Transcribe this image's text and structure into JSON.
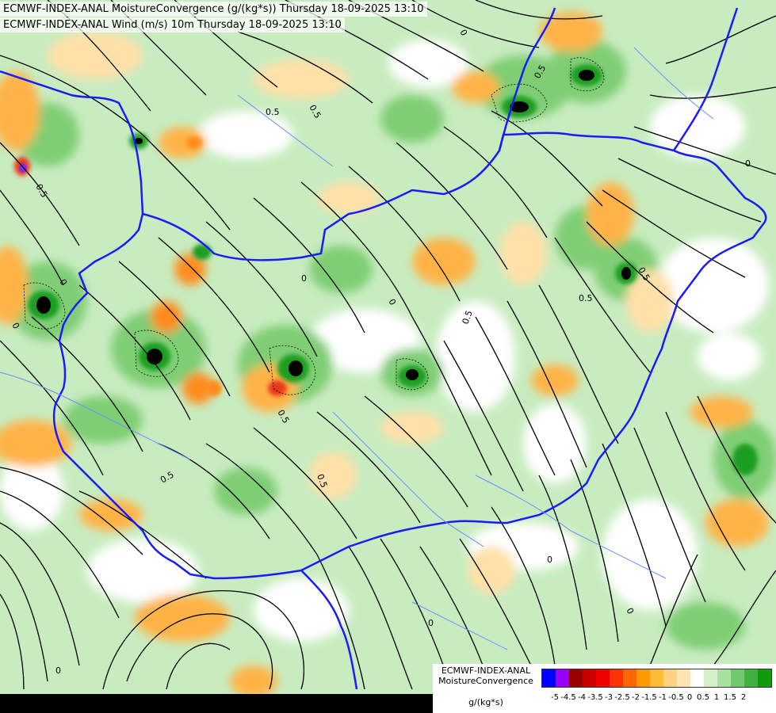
{
  "titles": {
    "line1": "ECMWF-INDEX-ANAL MoistureConvergence (g/(kg*s)) Thursday 18-09-2025 13:10",
    "line2": "ECMWF-INDEX-ANAL Wind (m/s) 10m Thursday 18-09-2025 13:10"
  },
  "legend": {
    "model": "ECMWF-INDEX-ANAL",
    "parameter": "MoistureConvergence",
    "units": "g/(kg*s)",
    "colors": [
      "#0000ff",
      "#9900ff",
      "#990000",
      "#cc0000",
      "#ee0000",
      "#ff3300",
      "#ff6600",
      "#ff9900",
      "#ffbb33",
      "#ffd27f",
      "#ffe5b4",
      "#ffffff",
      "#d4f0c8",
      "#a8e0a0",
      "#70c870",
      "#40b040",
      "#109a10"
    ],
    "tick_labels": [
      "-5",
      "-4.5",
      "-4",
      "-3.5",
      "-3",
      "-2.5",
      "-2",
      "-1.5",
      "-1",
      "-0.5",
      "0",
      "0.5",
      "1",
      "1.5",
      "2"
    ]
  },
  "map": {
    "contour_labels": [
      "0.5",
      "0",
      "0.5",
      "0",
      "0.5",
      "0",
      "0.5",
      "0",
      "0.5",
      "0",
      "0.5",
      "0",
      "0.5",
      "0",
      "0.5",
      "0",
      "0.5",
      "0",
      "0.5",
      "0"
    ],
    "fill_palette": {
      "zero": "#ffffff",
      "light_green": "#c8ecc0",
      "mid_green": "#7fce74",
      "dark_green": "#1e9e22",
      "black": "#000000",
      "light_orange": "#ffe0a8",
      "orange": "#ffb347",
      "dark_orange": "#ff8c1a",
      "red": "#e8381a",
      "purple": "#8a2be2"
    },
    "border_color": "#1a1aff",
    "river_color": "#6a8cff",
    "streamline_color": "#000000"
  }
}
